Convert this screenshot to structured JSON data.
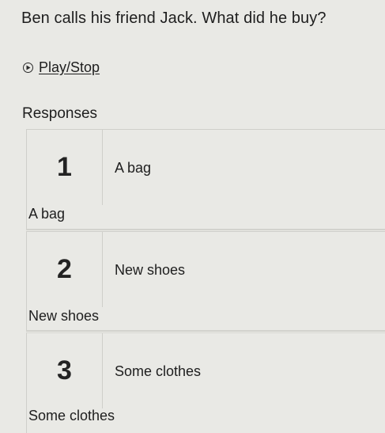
{
  "question": "Ben calls his friend Jack. What did he buy?",
  "play": {
    "icon": "play-circle-icon",
    "label": "Play/Stop"
  },
  "responses": {
    "heading": "Responses",
    "items": [
      {
        "number": "1",
        "text": "A bag",
        "caption": "A bag"
      },
      {
        "number": "2",
        "text": "New shoes",
        "caption": "New shoes"
      },
      {
        "number": "3",
        "text": "Some clothes",
        "caption": "Some clothes"
      }
    ]
  }
}
